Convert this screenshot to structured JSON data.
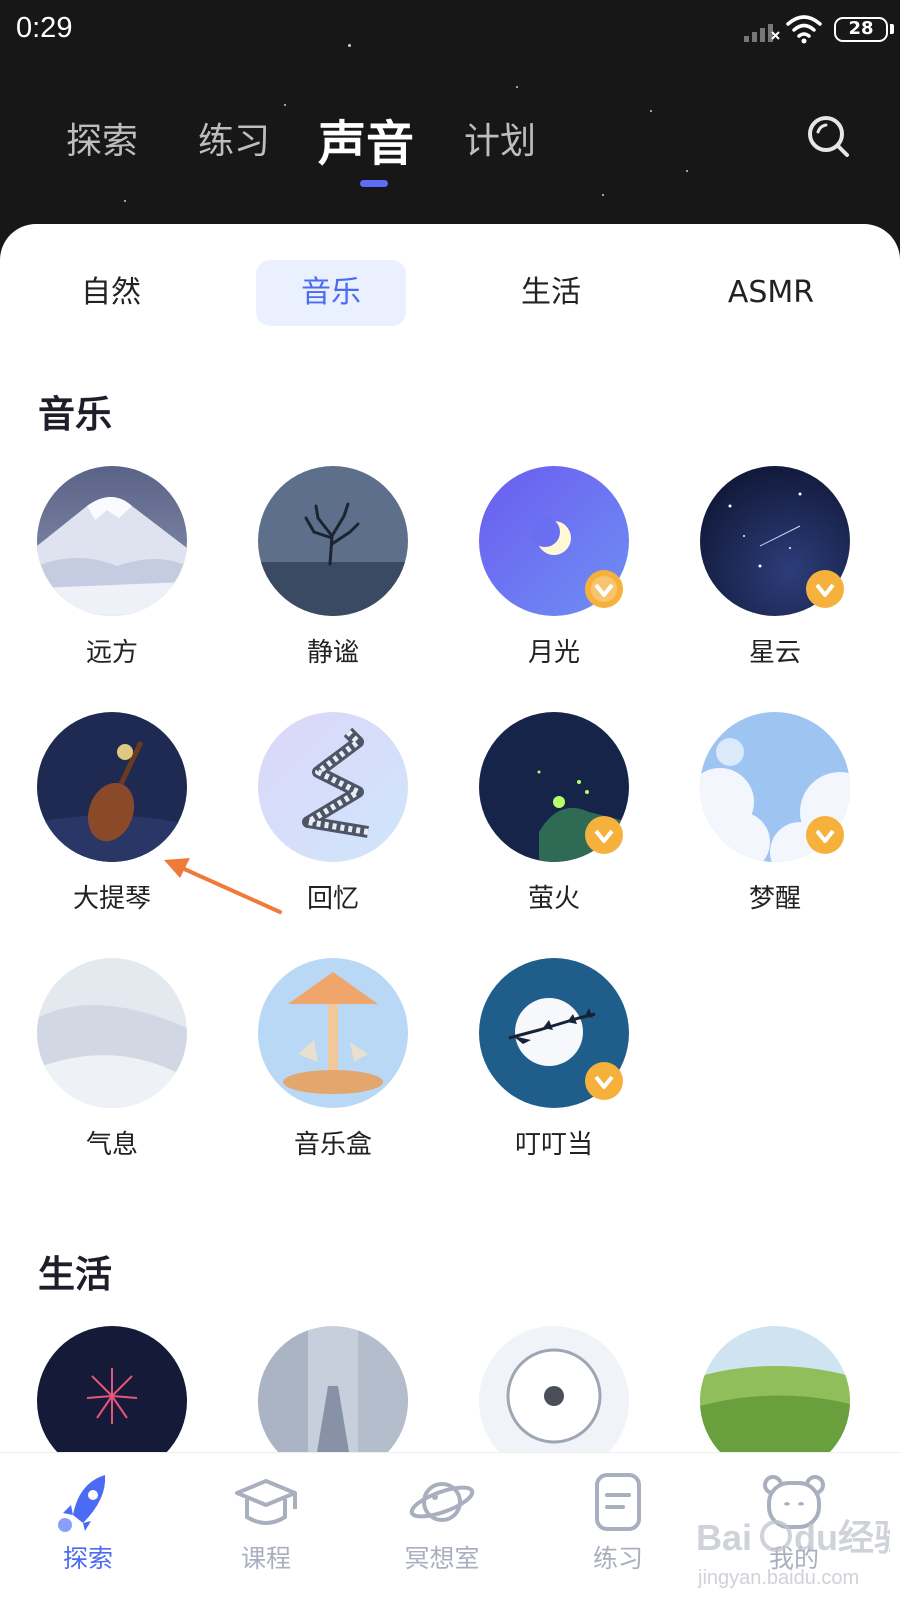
{
  "status": {
    "time": "0:29",
    "battery": "28"
  },
  "top_tabs": [
    {
      "label": "探索"
    },
    {
      "label": "练习"
    },
    {
      "label": "声音"
    },
    {
      "label": "计划"
    }
  ],
  "sub_tabs": [
    {
      "label": "自然"
    },
    {
      "label": "音乐"
    },
    {
      "label": "生活"
    },
    {
      "label": "ASMR"
    }
  ],
  "sections": {
    "music": {
      "title": "音乐",
      "items": [
        {
          "label": "远方"
        },
        {
          "label": "静谧"
        },
        {
          "label": "月光",
          "premium": true
        },
        {
          "label": "星云",
          "premium": true
        },
        {
          "label": "大提琴"
        },
        {
          "label": "回忆"
        },
        {
          "label": "萤火",
          "premium": true
        },
        {
          "label": "梦醒",
          "premium": true
        },
        {
          "label": "气息"
        },
        {
          "label": "音乐盒"
        },
        {
          "label": "叮叮当",
          "premium": true
        }
      ]
    },
    "life": {
      "title": "生活"
    }
  },
  "bottom_nav": [
    {
      "label": "探索",
      "icon": "rocket-icon"
    },
    {
      "label": "课程",
      "icon": "graduation-cap-icon"
    },
    {
      "label": "冥想室",
      "icon": "planet-icon"
    },
    {
      "label": "练习",
      "icon": "note-icon"
    },
    {
      "label": "我的",
      "icon": "bear-icon"
    }
  ],
  "watermark": {
    "text": "Baidu经验",
    "url": "jingyan.baidu.com"
  },
  "colors": {
    "accent": "#4c6bf4",
    "header_bg": "#171717",
    "badge": "#f6b13c"
  }
}
